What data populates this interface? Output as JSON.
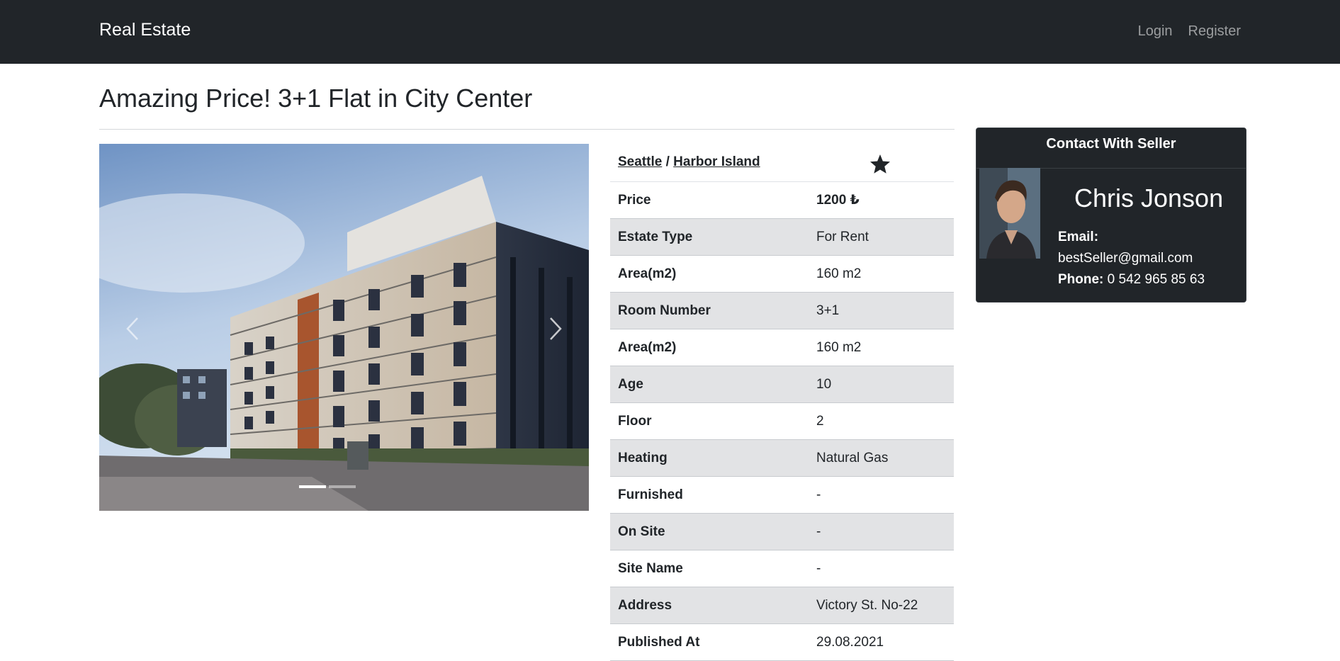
{
  "navbar": {
    "brand": "Real Estate",
    "login": "Login",
    "register": "Register"
  },
  "listing": {
    "title": "Amazing Price! 3+1 Flat in City Center",
    "city": "Seattle",
    "separator": "/",
    "district": "Harbor Island",
    "favorite_icon": "star-icon",
    "carousel": {
      "slide_count": 2,
      "active_slide": 1
    },
    "details": [
      {
        "label": "Price",
        "value": "1200 ₺"
      },
      {
        "label": "Estate Type",
        "value": "For Rent"
      },
      {
        "label": "Area(m2)",
        "value": "160 m2"
      },
      {
        "label": "Room Number",
        "value": "3+1"
      },
      {
        "label": "Area(m2)",
        "value": "160 m2"
      },
      {
        "label": "Age",
        "value": "10"
      },
      {
        "label": "Floor",
        "value": "2"
      },
      {
        "label": "Heating",
        "value": "Natural Gas"
      },
      {
        "label": "Furnished",
        "value": "-"
      },
      {
        "label": "On Site",
        "value": "-"
      },
      {
        "label": "Site Name",
        "value": "-"
      },
      {
        "label": "Address",
        "value": "Victory St. No-22"
      },
      {
        "label": "Published At",
        "value": "29.08.2021"
      }
    ]
  },
  "seller": {
    "card_title": "Contact With Seller",
    "name": "Chris Jonson",
    "email_label": "Email:",
    "email": "bestSeller@gmail.com",
    "phone_label": "Phone:",
    "phone": "0 542 965 85 63"
  },
  "colors": {
    "navbar_bg": "#212529",
    "striped_row": "#e2e3e5",
    "card_bg": "#212529"
  }
}
